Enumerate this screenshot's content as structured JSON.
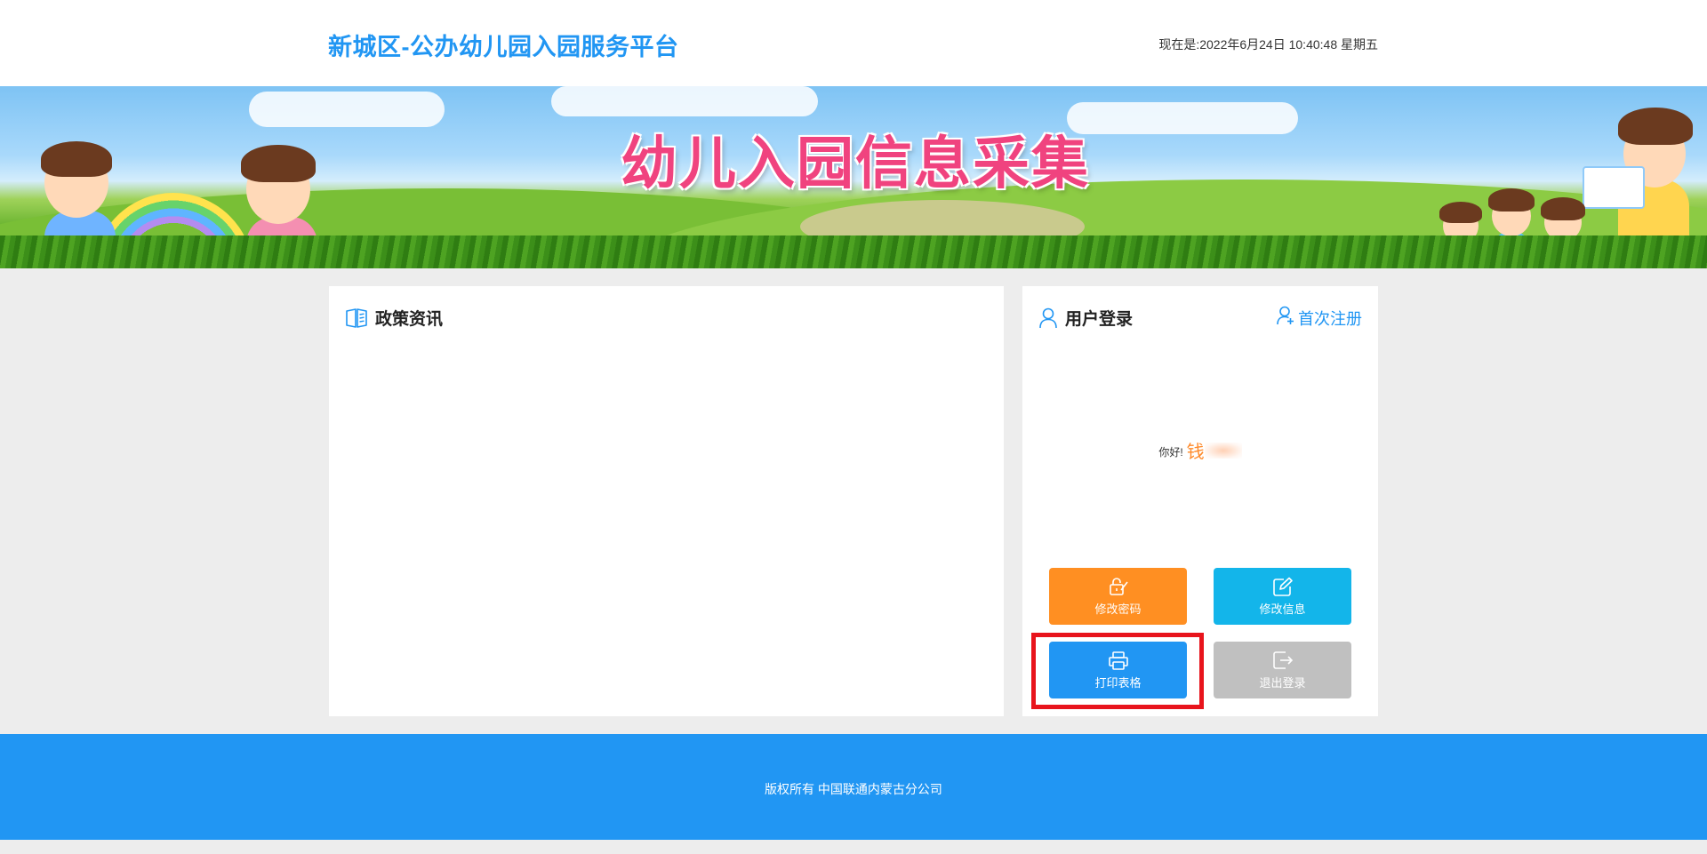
{
  "header": {
    "site_title": "新城区-公办幼儿园入园服务平台",
    "clock_text": "现在是:2022年6月24日 10:40:48 星期五"
  },
  "banner": {
    "title": "幼儿入园信息采集"
  },
  "news_panel": {
    "title": "政策资讯",
    "icon": "book-icon"
  },
  "login_panel": {
    "title": "用户登录",
    "icon": "user-icon",
    "register_label": "首次注册",
    "register_icon": "user-add-icon",
    "greeting": "你好!",
    "user_name": "钱",
    "buttons": {
      "change_password": "修改密码",
      "edit_info": "修改信息",
      "print_form": "打印表格",
      "logout": "退出登录"
    }
  },
  "footer": {
    "copyright": "版权所有 中国联通内蒙古分公司"
  },
  "colors": {
    "accent": "#2196f3",
    "orange": "#ff8f22",
    "cyan": "#13b5ea",
    "grey_button": "#c0c0c0",
    "highlight": "#e8141c",
    "banner_title": "#f0437f"
  }
}
